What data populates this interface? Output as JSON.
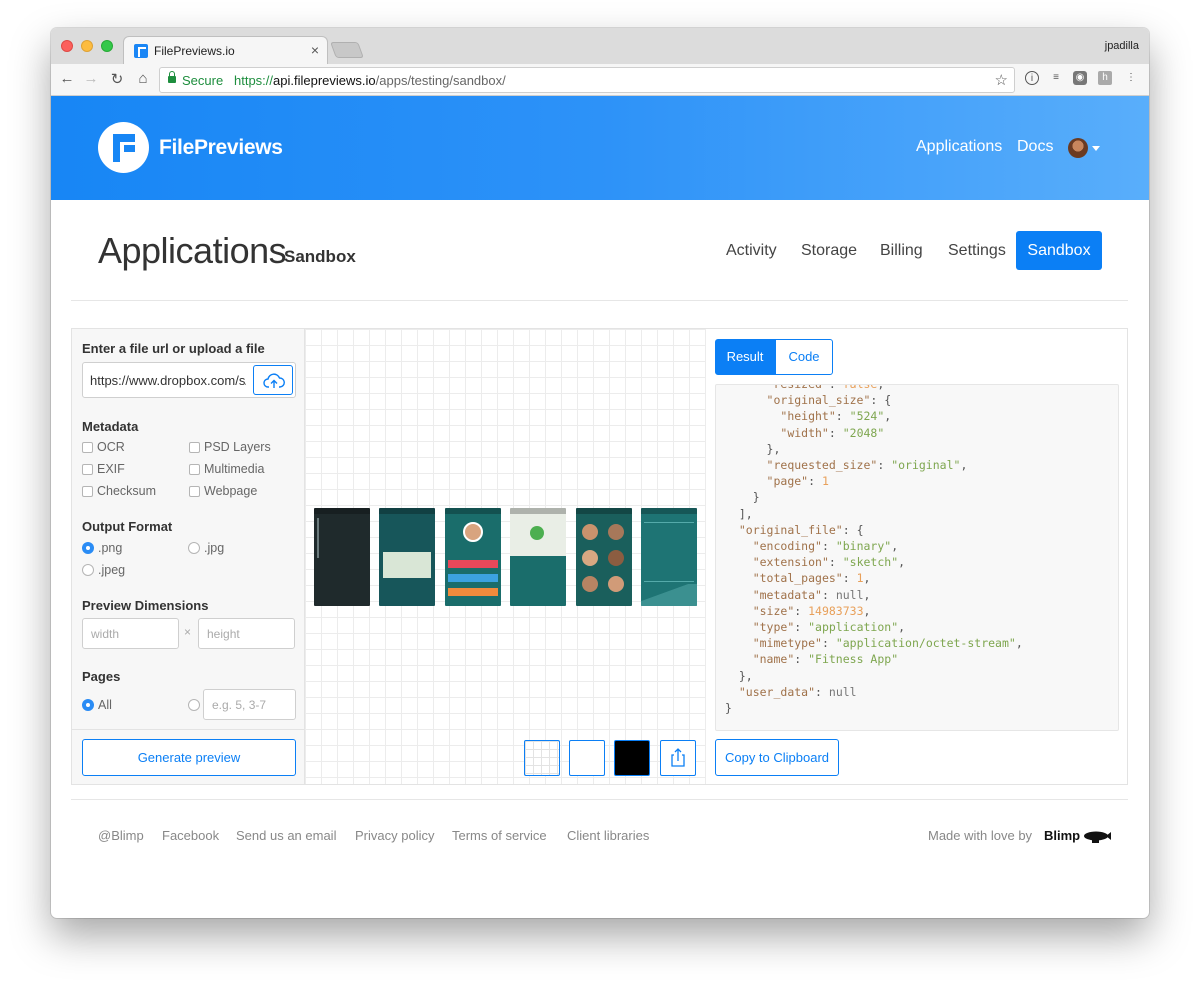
{
  "browser": {
    "tab_title": "FilePreviews.io",
    "user": "jpadilla",
    "secure_label": "Secure",
    "url_scheme": "https://",
    "url_host": "api.filepreviews.io",
    "url_path": "/apps/testing/sandbox/"
  },
  "header": {
    "brand": "FilePreviews",
    "nav": [
      "Applications",
      "Docs"
    ]
  },
  "page": {
    "title": "Applications",
    "subtitle": "Sandbox",
    "tabs": [
      "Activity",
      "Storage",
      "Billing",
      "Settings",
      "Sandbox"
    ],
    "active_tab": "Sandbox"
  },
  "form": {
    "file_label": "Enter a file url or upload a file",
    "file_value": "https://www.dropbox.com/s/fitness-app.sketch",
    "metadata_label": "Metadata",
    "metadata": [
      "OCR",
      "PSD Layers",
      "EXIF",
      "Multimedia",
      "Checksum",
      "Webpage"
    ],
    "format_label": "Output Format",
    "formats": [
      ".png",
      ".jpg",
      ".jpeg"
    ],
    "selected_format": ".png",
    "dimensions_label": "Preview Dimensions",
    "width_placeholder": "width",
    "height_placeholder": "height",
    "dim_separator": "×",
    "pages_label": "Pages",
    "pages_all": "All",
    "pages_placeholder": "e.g. 5, 3-7",
    "generate_label": "Generate preview"
  },
  "result": {
    "tabs": [
      "Result",
      "Code"
    ],
    "active_tab": "Result",
    "copy_label": "Copy to Clipboard"
  },
  "footer": {
    "links": [
      "@Blimp",
      "Facebook",
      "Send us an email",
      "Privacy policy",
      "Terms of service",
      "Client libraries"
    ],
    "made_with": "Made with love by",
    "blimp": "Blimp"
  },
  "colors": {
    "accent": "#0b7ff5",
    "header_start": "#1786f5",
    "header_end": "#59aefb"
  }
}
